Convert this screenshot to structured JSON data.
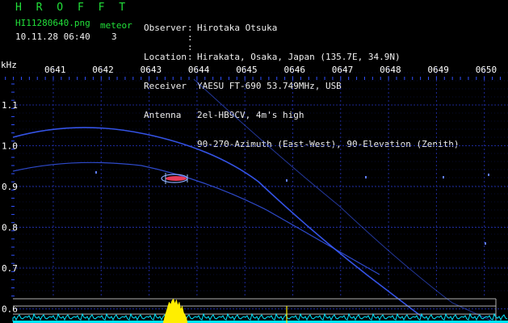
{
  "header": {
    "title": "H R O F F T",
    "filename": "HI11280640.png",
    "meteor_label": "meteor",
    "datetime": "10.11.28 06:40",
    "meteor_count": "3",
    "info_keys": [
      "Observer",
      "Location",
      "Receiver",
      "Antenna",
      "",
      ""
    ],
    "info_vals": [
      "Hirotaka Otsuka",
      "Hirakata, Osaka, Japan (135.7E, 34.9N)",
      "YAESU FT-690 53.749MHz, USB",
      "2el-HB9CV, 4m's high",
      "90-270-Azimuth (East-West), 90-Elevation (Zenith)",
      ""
    ]
  },
  "axes": {
    "unit": "kHz",
    "y_ticks": [
      "1.1",
      "1.0",
      "0.9",
      "0.8",
      "0.7",
      "0.6"
    ],
    "y_values": [
      1.1,
      1.0,
      0.9,
      0.8,
      0.7,
      0.6
    ],
    "x_ticks": [
      "0641",
      "0642",
      "0643",
      "0644",
      "0645",
      "0646",
      "0647",
      "0648",
      "0649",
      "0650"
    ],
    "ylim": [
      0.58,
      1.17
    ]
  },
  "colors": {
    "background": "#000000",
    "grid": "#1e2b9c",
    "trace": "#3a5cff",
    "meteor_echo": "#ff4060",
    "baseline": "#00e5ff",
    "burst": "#ffee00",
    "header_title": "#22e03a",
    "text": "#f0f0f0"
  }
}
